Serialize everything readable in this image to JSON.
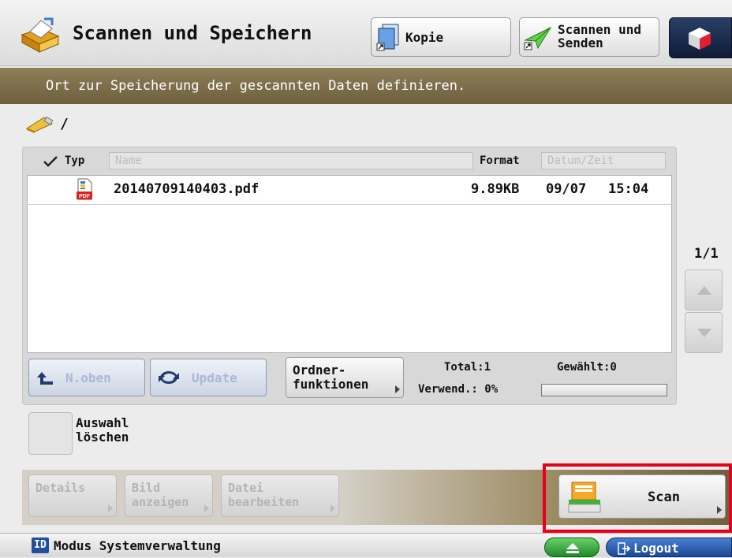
{
  "header": {
    "title": "Scannen und Speichern",
    "kopie_label": "Kopie",
    "scan_send_line1": "Scannen und",
    "scan_send_line2": "Senden"
  },
  "message": "Ort zur Speicherung der gescannten Daten definieren.",
  "path": "/",
  "columns": {
    "typ": "Typ",
    "name": "Name",
    "format": "Format",
    "datum": "Datum/Zeit"
  },
  "files": [
    {
      "name": "20140709140403.pdf",
      "size": "9.89KB",
      "date": "09/07",
      "time": "15:04",
      "type_badge": "PDF"
    }
  ],
  "pager": "1/1",
  "panel_buttons": {
    "up": "N.oben",
    "update": "Update",
    "folder_line1": "Ordner-",
    "folder_line2": "funktionen"
  },
  "stats": {
    "total": "Total:1",
    "used": "Verwend.: 0%",
    "selected": "Gewählt:0",
    "used_fraction": 0
  },
  "clear_selection": {
    "line1": "Auswahl",
    "line2": "löschen"
  },
  "action_buttons": {
    "details": "Details",
    "bild_line1": "Bild",
    "bild_line2": "anzeigen",
    "datei_line1": "Datei",
    "datei_line2": "bearbeiten"
  },
  "scan_button": "Scan",
  "footer": {
    "badge": "ID",
    "mode": "Modus Systemverwaltung",
    "logout": "Logout"
  },
  "colors": {
    "msgbar": "#7d6e4c",
    "highlight": "#e8001a",
    "footer_blue": "#1f4f9e"
  }
}
